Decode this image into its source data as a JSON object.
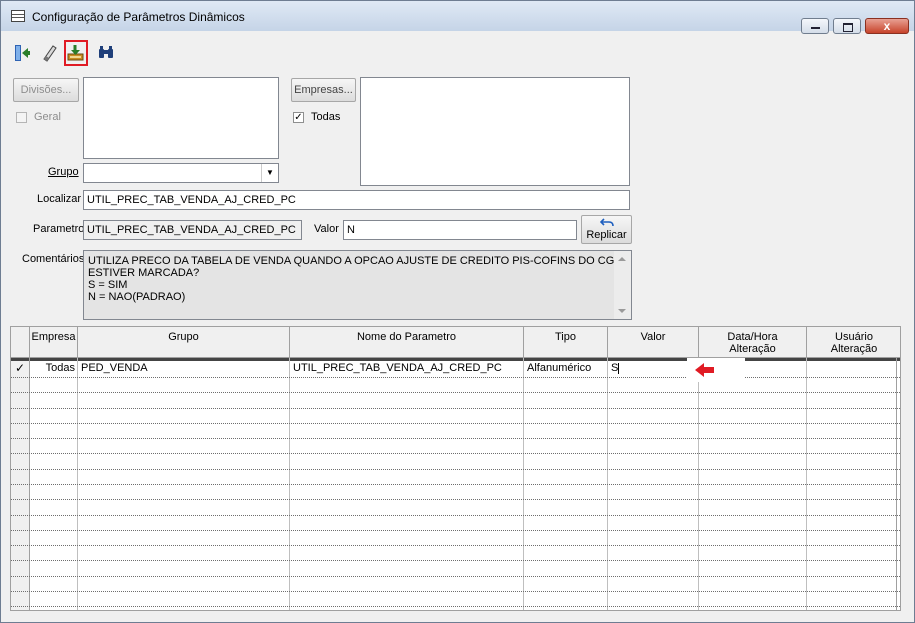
{
  "window": {
    "title": "Configuração de Parâmetros Dinâmicos",
    "close_symbol": "x"
  },
  "toolbar": {
    "items": [
      {
        "name": "exit-icon"
      },
      {
        "name": "eraser-icon"
      },
      {
        "name": "save-download-icon",
        "selected": true
      },
      {
        "name": "binoculars-icon"
      }
    ]
  },
  "divisoes": {
    "button_label": "Divisões...",
    "geral_label": "Geral",
    "geral_checked": false
  },
  "empresas": {
    "button_label": "Empresas...",
    "todas_label": "Todas",
    "todas_checked": true,
    "check_glyph": "✓"
  },
  "grupo": {
    "label": "Grupo",
    "value": ""
  },
  "localizar": {
    "label": "Localizar",
    "value": "UTIL_PREC_TAB_VENDA_AJ_CRED_PC"
  },
  "parametro": {
    "label": "Parametro",
    "value": "UTIL_PREC_TAB_VENDA_AJ_CRED_PC",
    "valor_label": "Valor",
    "valor_value": "N"
  },
  "replicar": {
    "label": "Replicar",
    "icon": "undo-arrow-icon"
  },
  "comentarios": {
    "label": "Comentários",
    "lines": [
      "UTILIZA PRECO DA TABELA DE VENDA QUANDO A OPCAO AJUSTE DE CREDITO PIS-COFINS DO CGO",
      "ESTIVER MARCADA?",
      "S = SIM",
      "N = NAO(PADRAO)"
    ]
  },
  "grid": {
    "columns": [
      "Empresa",
      "Grupo",
      "Nome do Parametro",
      "Tipo",
      "Valor",
      "Data/Hora Alteração",
      "Usuário Alteração"
    ],
    "rows": [
      {
        "selected_mark": "✓",
        "empresa": "Todas",
        "grupo": "PED_VENDA",
        "nome": "UTIL_PREC_TAB_VENDA_AJ_CRED_PC",
        "tipo": "Alfanumérico",
        "valor": "S",
        "data_hora": "",
        "usuario": ""
      }
    ]
  },
  "colors": {
    "highlight": "#e01b24",
    "arrow": "#e01b24"
  }
}
